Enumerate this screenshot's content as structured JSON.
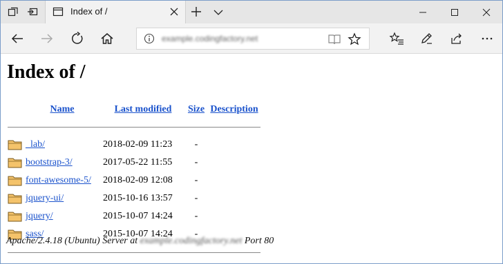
{
  "browser": {
    "tab_title": "Index of /",
    "address_url": "example.codingfactory.net"
  },
  "page": {
    "title": "Index of /",
    "headers": {
      "name": "Name",
      "last_modified": "Last modified",
      "size": "Size",
      "description": "Description"
    },
    "rows": [
      {
        "name": "_lab/",
        "modified": "2018-02-09 11:23",
        "size": "-",
        "icon": "folder-icon"
      },
      {
        "name": "bootstrap-3/",
        "modified": "2017-05-22 11:55",
        "size": "-",
        "icon": "folder-icon"
      },
      {
        "name": "font-awesome-5/",
        "modified": "2018-02-09 12:08",
        "size": "-",
        "icon": "folder-icon"
      },
      {
        "name": "jquery-ui/",
        "modified": "2015-10-16 13:57",
        "size": "-",
        "icon": "folder-icon"
      },
      {
        "name": "jquery/",
        "modified": "2015-10-07 14:24",
        "size": "-",
        "icon": "folder-icon"
      },
      {
        "name": "sass/",
        "modified": "2015-10-07 14:24",
        "size": "-",
        "icon": "folder-icon"
      }
    ],
    "footer": {
      "prefix": "Apache/2.4.18 (Ubuntu) Server at",
      "host": "example.codingfactory.net",
      "suffix": "Port 80"
    }
  },
  "colors": {
    "link": "#1a52cc",
    "folder_fill": "#f4c36b",
    "folder_stroke": "#7a5a1c"
  }
}
